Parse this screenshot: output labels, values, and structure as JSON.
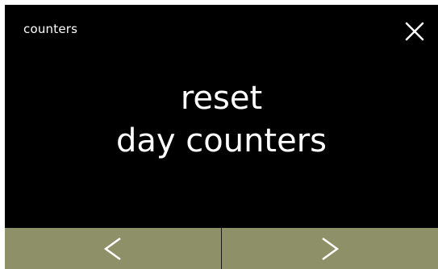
{
  "screen": {
    "title": "counters",
    "message_line1": "reset",
    "message_line2": "day counters"
  },
  "icons": {
    "close": "close-icon",
    "previous": "chevron-left-icon",
    "next": "chevron-right-icon"
  },
  "colors": {
    "background": "#000000",
    "text": "#ffffff",
    "nav_button": "#8e9068"
  }
}
